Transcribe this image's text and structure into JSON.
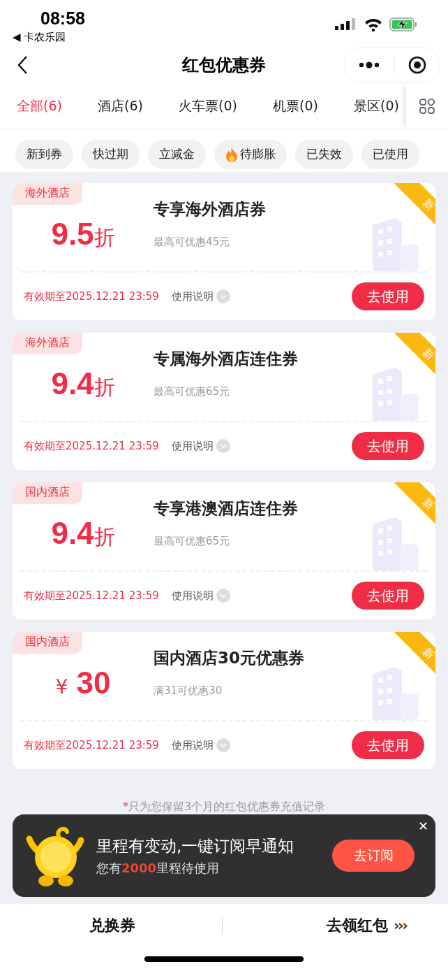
{
  "status_bar": {
    "time": "08:58",
    "back_app": "◀ 卡农乐园"
  },
  "nav": {
    "title": "红包优惠券"
  },
  "tabs": [
    {
      "label": "全部(6)",
      "selected": true
    },
    {
      "label": "酒店(6)",
      "selected": false
    },
    {
      "label": "火车票(0)",
      "selected": false
    },
    {
      "label": "机票(0)",
      "selected": false
    },
    {
      "label": "景区(0)",
      "selected": false
    }
  ],
  "filters": [
    {
      "label": "新到券",
      "hot": false
    },
    {
      "label": "快过期",
      "hot": false
    },
    {
      "label": "立减金",
      "hot": false
    },
    {
      "label": "待膨胀",
      "hot": true
    },
    {
      "label": "已失效",
      "hot": false
    },
    {
      "label": "已使用",
      "hot": false
    }
  ],
  "coupons": [
    {
      "tag": "海外酒店",
      "kind": "discount",
      "value": "9.5",
      "unit": "折",
      "title": "专享海外酒店券",
      "subtitle": "最高可优惠45元",
      "ribbon": "新",
      "expiry": "有效期至2025.12.21 23:59",
      "instructions": "使用说明",
      "button": "去使用"
    },
    {
      "tag": "海外酒店",
      "kind": "discount",
      "value": "9.4",
      "unit": "折",
      "title": "专属海外酒店连住券",
      "subtitle": "最高可优惠65元",
      "ribbon": "新",
      "expiry": "有效期至2025.12.21 23:59",
      "instructions": "使用说明",
      "button": "去使用"
    },
    {
      "tag": "国内酒店",
      "kind": "discount",
      "value": "9.4",
      "unit": "折",
      "title": "专享港澳酒店连住券",
      "subtitle": "最高可优惠65元",
      "ribbon": "新",
      "expiry": "有效期至2025.12.21 23:59",
      "instructions": "使用说明",
      "button": "去使用"
    },
    {
      "tag": "国内酒店",
      "kind": "amount",
      "value": "30",
      "unit": "¥",
      "title": "国内酒店30元优惠券",
      "subtitle": "满31可优惠30",
      "ribbon": "新",
      "expiry": "有效期至2025.12.21 23:59",
      "instructions": "使用说明",
      "button": "去使用"
    }
  ],
  "footnote": {
    "mark": "*",
    "text": "只为您保留3个月的红包优惠券充值记录"
  },
  "bottom_bar": {
    "left": "兑换券",
    "right": "去领红包",
    "right_arrows": "›››"
  },
  "banner": {
    "title": "里程有变动,一键订阅早通知",
    "subtitle_before": "您有",
    "subtitle_highlight": "2000",
    "subtitle_after": "里程待使用",
    "button": "去订阅",
    "close": "✕"
  }
}
